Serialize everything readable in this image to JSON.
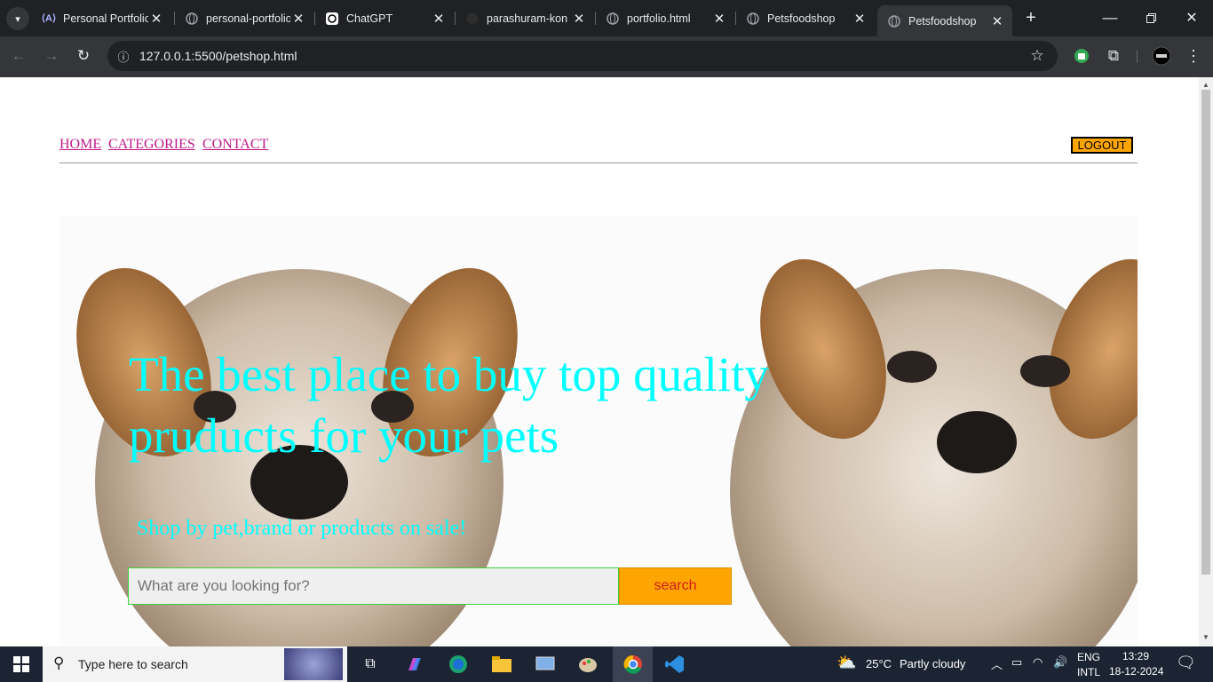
{
  "browser": {
    "tabs": [
      {
        "title": "Personal Portfolio",
        "favicon": "vite-icon"
      },
      {
        "title": "personal-portfolio",
        "favicon": "globe-icon"
      },
      {
        "title": "ChatGPT",
        "favicon": "chatgpt-icon"
      },
      {
        "title": "parashuram-kon",
        "favicon": "github-icon"
      },
      {
        "title": "portfolio.html",
        "favicon": "globe-icon"
      },
      {
        "title": "Petsfoodshop",
        "favicon": "globe-icon"
      },
      {
        "title": "Petsfoodshop",
        "favicon": "globe-icon",
        "active": true
      }
    ],
    "url": "127.0.0.1:5500/petshop.html"
  },
  "nav": {
    "home": "HOME",
    "categories": "CATEGORIES",
    "contact": "CONTACT",
    "logout": "LOGOUT"
  },
  "hero": {
    "headline": "The best place to buy top quality pruducts for your pets",
    "subheadline": "Shop by pet,brand or products on sale!",
    "search_placeholder": "What are you looking for?",
    "search_button": "search"
  },
  "taskbar": {
    "search_placeholder": "Type here to search",
    "weather_temp": "25°C",
    "weather_desc": "Partly cloudy",
    "lang_top": "ENG",
    "lang_bottom": "INTL",
    "time": "13:29",
    "date": "18-12-2024"
  },
  "colors": {
    "accent_cyan": "#00ffff",
    "nav_link": "#c0198a",
    "button_orange": "#ffa500",
    "search_text_red": "#d21a1a"
  }
}
